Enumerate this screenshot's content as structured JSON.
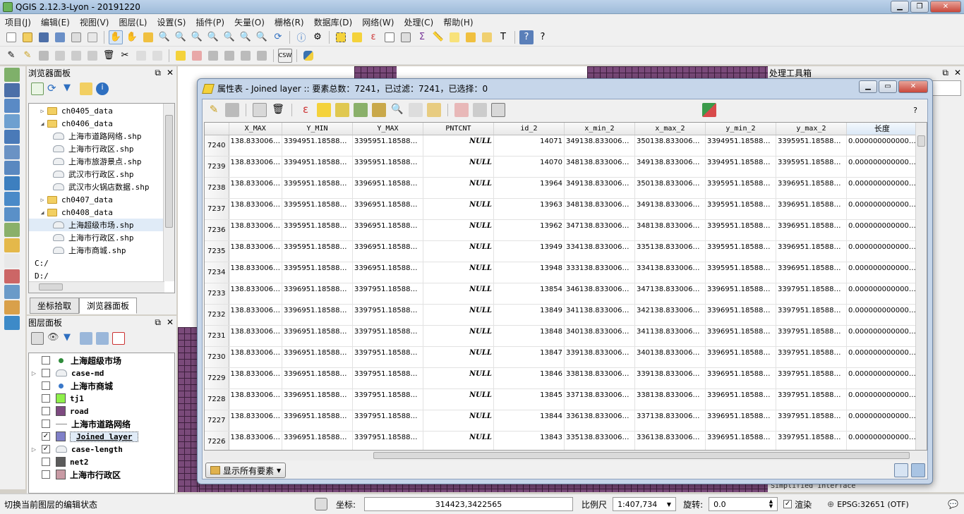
{
  "window": {
    "title": "QGIS 2.12.3-Lyon - 20191220"
  },
  "menubar": [
    "项目(J)",
    "编辑(E)",
    "视图(V)",
    "图层(L)",
    "设置(S)",
    "插件(P)",
    "矢量(O)",
    "栅格(R)",
    "数据库(D)",
    "网络(W)",
    "处理(C)",
    "帮助(H)"
  ],
  "browser_panel": {
    "title": "浏览器面板",
    "items": [
      {
        "label": "ch0405_data",
        "type": "folder",
        "indent": 0,
        "expanded": false
      },
      {
        "label": "ch0406_data",
        "type": "folder",
        "indent": 0,
        "expanded": true
      },
      {
        "label": "上海市道路网络.shp",
        "type": "file",
        "indent": 1
      },
      {
        "label": "上海市行政区.shp",
        "type": "file",
        "indent": 1
      },
      {
        "label": "上海市旅游景点.shp",
        "type": "file",
        "indent": 1
      },
      {
        "label": "武汉市行政区.shp",
        "type": "file",
        "indent": 1
      },
      {
        "label": "武汉市火锅店数据.shp",
        "type": "file",
        "indent": 1
      },
      {
        "label": "ch0407_data",
        "type": "folder",
        "indent": 0,
        "expanded": false
      },
      {
        "label": "ch0408_data",
        "type": "folder",
        "indent": 0,
        "expanded": true
      },
      {
        "label": "上海超级市场.shp",
        "type": "file",
        "indent": 1,
        "selected": true
      },
      {
        "label": "上海市行政区.shp",
        "type": "file",
        "indent": 1
      },
      {
        "label": "上海市商城.shp",
        "type": "file",
        "indent": 1
      },
      {
        "label": "C:/",
        "type": "drive",
        "indent": 0
      },
      {
        "label": "D:/",
        "type": "drive",
        "indent": 0
      }
    ],
    "tabs": [
      "坐标拾取",
      "浏览器面板"
    ],
    "active_tab": 1
  },
  "layers_panel": {
    "title": "图层面板",
    "layers": [
      {
        "name": "上海超级市场",
        "checked": false,
        "symbol": "point",
        "color": "#2e8b3a"
      },
      {
        "name": "case-md",
        "checked": false,
        "symbol": "line-group",
        "color": "#c8c8c8",
        "expandable": true
      },
      {
        "name": "上海市商城",
        "checked": false,
        "symbol": "point",
        "color": "#3a78c9"
      },
      {
        "name": "tj1",
        "checked": false,
        "symbol": "fill",
        "color": "#8ef04a"
      },
      {
        "name": "road",
        "checked": false,
        "symbol": "fill",
        "color": "#7d4a80"
      },
      {
        "name": "上海市道路网络",
        "checked": false,
        "symbol": "line",
        "color": "#8a8a8a"
      },
      {
        "name": "Joined layer",
        "checked": true,
        "symbol": "fill",
        "color": "#8080c8",
        "selected": true
      },
      {
        "name": "case-length",
        "checked": true,
        "symbol": "line-group",
        "color": "#c8c8c8",
        "expandable": true
      },
      {
        "name": "net2",
        "checked": false,
        "symbol": "fill",
        "color": "#5b5b5b"
      },
      {
        "name": "上海市行政区",
        "checked": false,
        "symbol": "fill",
        "color": "#c89aa4"
      }
    ]
  },
  "processing_panel": {
    "title": "处理工具箱",
    "bottom_text": "Simplified interface"
  },
  "attribute_table": {
    "title": "属性表 - Joined layer :: 要素总数：7241，已过滤：7241，已选择：0",
    "help": "?",
    "columns": [
      "X_MAX",
      "Y_MIN",
      "Y_MAX",
      "PNTCNT",
      "id_2",
      "x_min_2",
      "x_max_2",
      "y_min_2",
      "y_max_2",
      "长度"
    ],
    "rows": [
      {
        "fid": "7240",
        "cells": [
          "138.833006…",
          "3394951.18588…",
          "3395951.18588…",
          "NULL",
          "14071",
          "349138.833006…",
          "350138.833006…",
          "3394951.18588…",
          "3395951.18588…",
          "0.000000000000…"
        ]
      },
      {
        "fid": "7239",
        "cells": [
          "138.833006…",
          "3394951.18588…",
          "3395951.18588…",
          "NULL",
          "14070",
          "348138.833006…",
          "349138.833006…",
          "3394951.18588…",
          "3395951.18588…",
          "0.000000000000…"
        ]
      },
      {
        "fid": "7238",
        "cells": [
          "138.833006…",
          "3395951.18588…",
          "3396951.18588…",
          "NULL",
          "13964",
          "349138.833006…",
          "350138.833006…",
          "3395951.18588…",
          "3396951.18588…",
          "0.000000000000…"
        ]
      },
      {
        "fid": "7237",
        "cells": [
          "138.833006…",
          "3395951.18588…",
          "3396951.18588…",
          "NULL",
          "13963",
          "348138.833006…",
          "349138.833006…",
          "3395951.18588…",
          "3396951.18588…",
          "0.000000000000…"
        ]
      },
      {
        "fid": "7236",
        "cells": [
          "138.833006…",
          "3395951.18588…",
          "3396951.18588…",
          "NULL",
          "13962",
          "347138.833006…",
          "348138.833006…",
          "3395951.18588…",
          "3396951.18588…",
          "0.000000000000…"
        ]
      },
      {
        "fid": "7235",
        "cells": [
          "138.833006…",
          "3395951.18588…",
          "3396951.18588…",
          "NULL",
          "13949",
          "334138.833006…",
          "335138.833006…",
          "3395951.18588…",
          "3396951.18588…",
          "0.000000000000…"
        ]
      },
      {
        "fid": "7234",
        "cells": [
          "138.833006…",
          "3395951.18588…",
          "3396951.18588…",
          "NULL",
          "13948",
          "333138.833006…",
          "334138.833006…",
          "3395951.18588…",
          "3396951.18588…",
          "0.000000000000…"
        ]
      },
      {
        "fid": "7233",
        "cells": [
          "138.833006…",
          "3396951.18588…",
          "3397951.18588…",
          "NULL",
          "13854",
          "346138.833006…",
          "347138.833006…",
          "3396951.18588…",
          "3397951.18588…",
          "0.000000000000…"
        ]
      },
      {
        "fid": "7232",
        "cells": [
          "138.833006…",
          "3396951.18588…",
          "3397951.18588…",
          "NULL",
          "13849",
          "341138.833006…",
          "342138.833006…",
          "3396951.18588…",
          "3397951.18588…",
          "0.000000000000…"
        ]
      },
      {
        "fid": "7231",
        "cells": [
          "138.833006…",
          "3396951.18588…",
          "3397951.18588…",
          "NULL",
          "13848",
          "340138.833006…",
          "341138.833006…",
          "3396951.18588…",
          "3397951.18588…",
          "0.000000000000…"
        ]
      },
      {
        "fid": "7230",
        "cells": [
          "138.833006…",
          "3396951.18588…",
          "3397951.18588…",
          "NULL",
          "13847",
          "339138.833006…",
          "340138.833006…",
          "3396951.18588…",
          "3397951.18588…",
          "0.000000000000…"
        ]
      },
      {
        "fid": "7229",
        "cells": [
          "138.833006…",
          "3396951.18588…",
          "3397951.18588…",
          "NULL",
          "13846",
          "338138.833006…",
          "339138.833006…",
          "3396951.18588…",
          "3397951.18588…",
          "0.000000000000…"
        ]
      },
      {
        "fid": "7228",
        "cells": [
          "138.833006…",
          "3396951.18588…",
          "3397951.18588…",
          "NULL",
          "13845",
          "337138.833006…",
          "338138.833006…",
          "3396951.18588…",
          "3397951.18588…",
          "0.000000000000…"
        ]
      },
      {
        "fid": "7227",
        "cells": [
          "138.833006…",
          "3396951.18588…",
          "3397951.18588…",
          "NULL",
          "13844",
          "336138.833006…",
          "337138.833006…",
          "3396951.18588…",
          "3397951.18588…",
          "0.000000000000…"
        ]
      },
      {
        "fid": "7226",
        "cells": [
          "138.833006…",
          "3396951.18588…",
          "3397951.18588…",
          "NULL",
          "13843",
          "335138.833006…",
          "336138.833006…",
          "3396951.18588…",
          "3397951.18588…",
          "0.000000000000…"
        ]
      }
    ],
    "show_all_label": "显示所有要素"
  },
  "statusbar": {
    "message": "切换当前图层的编辑状态",
    "coord_label": "坐标:",
    "coord_value": "314423,3422565",
    "scale_label": "比例尺",
    "scale_value": "1:407,734",
    "rotation_label": "旋转:",
    "rotation_value": "0.0",
    "render_label": "渲染",
    "render_checked": true,
    "crs": "EPSG:32651 (OTF)"
  },
  "colors": {
    "map_polygons": "#7a4a7a",
    "selection": "#e0ebf7",
    "accent": "#3a78c9"
  }
}
